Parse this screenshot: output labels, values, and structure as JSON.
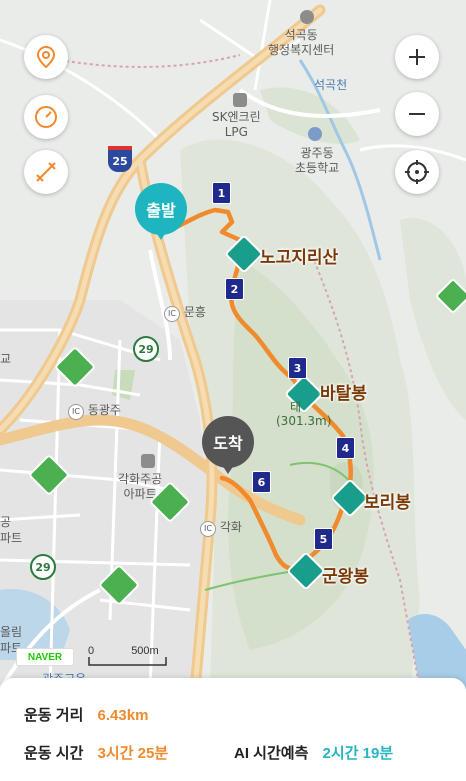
{
  "map": {
    "place_labels": {
      "seokgok_center_line1": "석곡동",
      "seokgok_center_line2": "행정복지센터",
      "seokgokcheon": "석곡천",
      "sk_line1": "SK엔크린",
      "sk_line2": "LPG",
      "gwangju_school_line1": "광주동",
      "gwangju_school_line2": "초등학교",
      "ic_munheung": "문흥",
      "ic_donggwangju": "동광주",
      "ic_gakhwa": "각화",
      "apt_line1": "각화주공",
      "apt_line2": "아파트",
      "left_fragment_1": "교",
      "left_fragment_2": "공",
      "left_fragment_3": "파트",
      "left_fragment_4": "올림",
      "left_fragment_5": "파트",
      "bottom_fragment": "광주고운",
      "ic_prefix": "IC"
    },
    "highway_shields": {
      "h25": "25",
      "h29a": "29",
      "h29b": "29"
    },
    "peaks": {
      "nogojiri": "노고지리산",
      "batalbong": "바탈봉",
      "batal_elev_prefix": "태",
      "batal_elev": "(301.3m)",
      "boribong": "보리봉",
      "gunwangbong": "군왕봉"
    },
    "waypoints": [
      "1",
      "2",
      "3",
      "4",
      "5",
      "6"
    ],
    "start_label": "출발",
    "end_label": "도착",
    "naver_logo": "NAVER",
    "scale": {
      "zero": "0",
      "distance": "500m"
    },
    "controls": {
      "location_icon": "location-pin-icon",
      "speed_icon": "speedometer-icon",
      "route_icon": "route-icon",
      "zoom_in_icon": "plus-icon",
      "zoom_out_icon": "minus-icon",
      "recenter_icon": "crosshair-icon"
    },
    "colors": {
      "route": "#f08a2c",
      "start": "#1fb5c0",
      "end": "#555555",
      "waypoint": "#1f2a8c",
      "peak_icon": "#1a9e8c"
    }
  },
  "summary": {
    "distance_label": "운동 거리",
    "distance_value": "6.43km",
    "time_label": "운동 시간",
    "time_value": "3시간 25분",
    "ai_label": "AI 시간예측",
    "ai_value": "2시간 19분"
  }
}
